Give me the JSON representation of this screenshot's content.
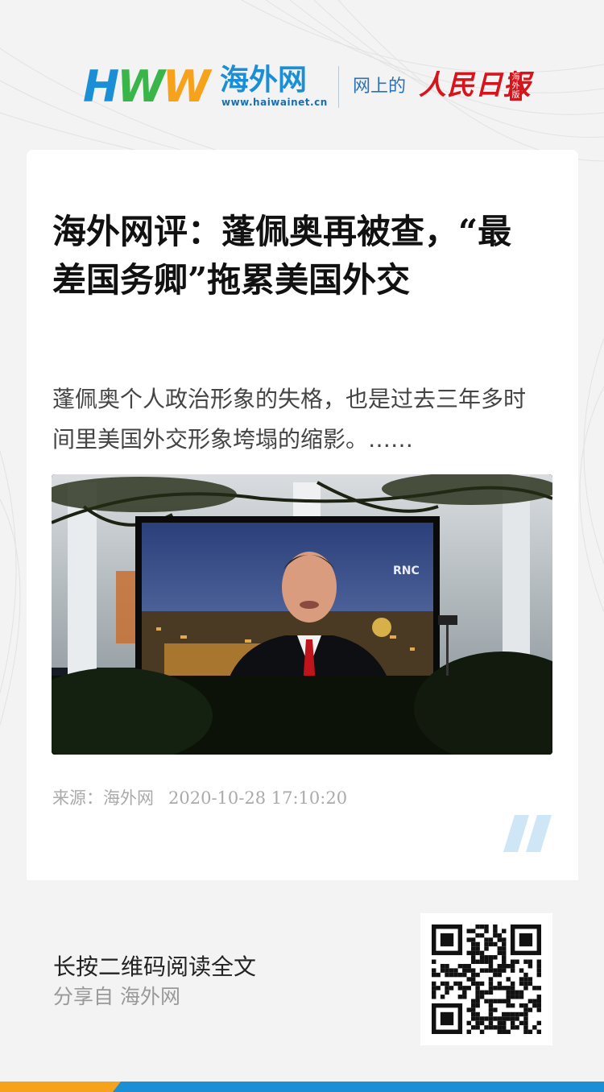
{
  "header": {
    "logo_mark": "HWW",
    "logo_name": "海外网",
    "logo_url": "www.haiwainet.cn",
    "slogan": "网上的",
    "partner_name": "人民日报",
    "partner_edition": "海外版"
  },
  "article": {
    "title": "海外网评：蓬佩奥再被查，“最差国务卿”拖累美国外交",
    "summary": "蓬佩奥个人政治形象的失格，也是过去三年多时间里美国外交形象垮塌的缩影。……",
    "image_screen_text": "RNC",
    "source": "来源：海外网",
    "timestamp": "2020-10-28 17:10:20"
  },
  "footer": {
    "cta": "长按二维码阅读全文",
    "share": "分享自 海外网"
  },
  "colors": {
    "brand_blue": "#1a8fd6",
    "brand_green": "#39b54a",
    "brand_orange": "#f7a21b",
    "partner_red": "#d7141c",
    "accent_light_blue": "#cfe6f7"
  }
}
